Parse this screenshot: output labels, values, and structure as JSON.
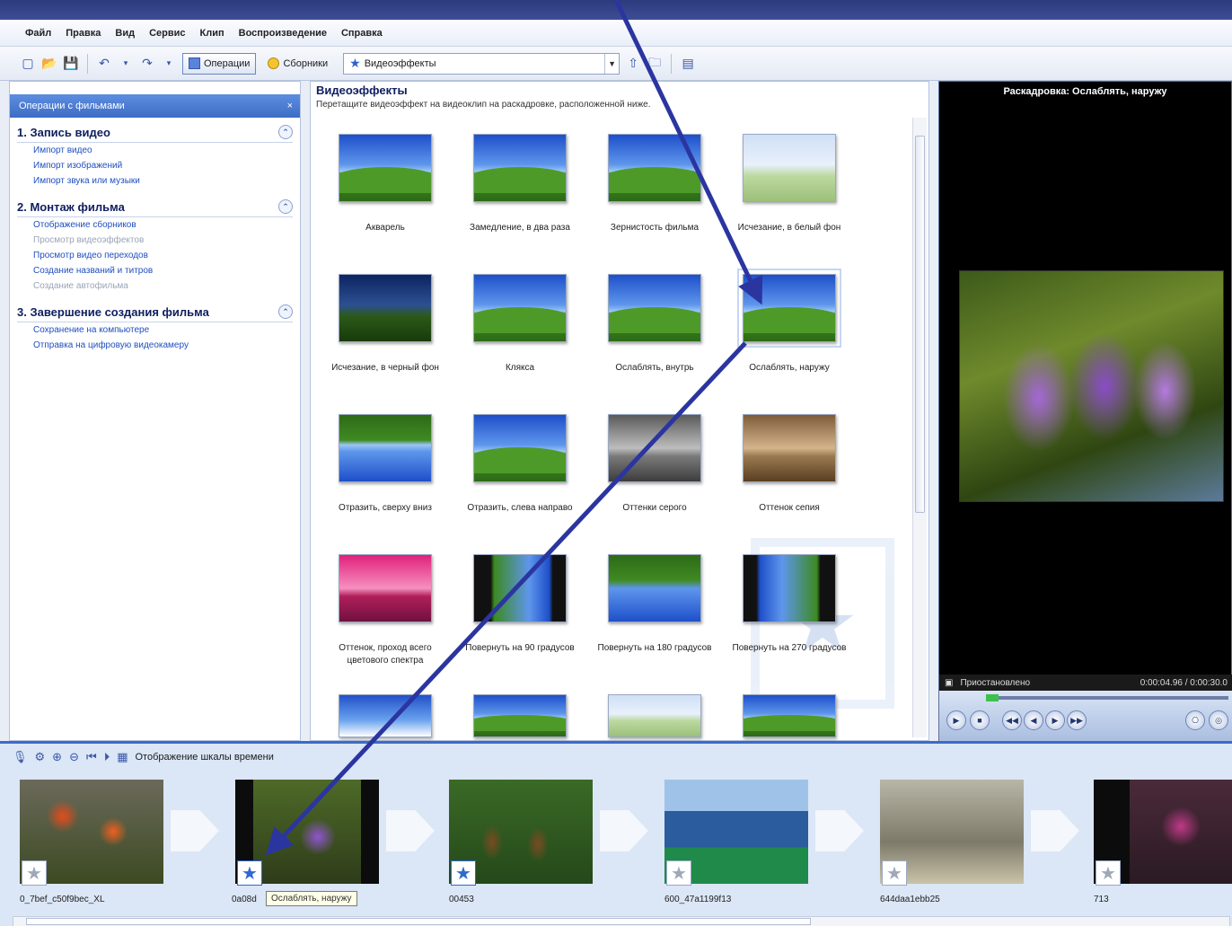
{
  "menu": [
    "Файл",
    "Правка",
    "Вид",
    "Сервис",
    "Клип",
    "Воспроизведение",
    "Справка"
  ],
  "toolbar": {
    "operations": "Операции",
    "collections": "Сборники",
    "combo_value": "Видеоэффекты"
  },
  "taskpane": {
    "header": "Операции с фильмами",
    "groups": [
      {
        "title": "1. Запись видео",
        "links": [
          "Импорт видео",
          "Импорт изображений",
          "Импорт звука или музыки"
        ]
      },
      {
        "title": "2. Монтаж фильма",
        "links": [
          "Отображение сборников",
          "Просмотр видеоэффектов",
          "Просмотр видео переходов",
          "Создание названий и титров",
          "Создание автофильма"
        ]
      },
      {
        "title": "3. Завершение создания фильма",
        "links": [
          "Сохранение на компьютере",
          "Отправка на цифровую видеокамеру"
        ]
      }
    ]
  },
  "center": {
    "title": "Видеоэффекты",
    "subtitle": "Перетащите видеоэффект на видеоклип на раскадровке, расположенной ниже.",
    "effects": [
      "Акварель",
      "Замедление, в два раза",
      "Зернистость фильма",
      "Исчезание, в белый фон",
      "Исчезание, в черный фон",
      "Клякса",
      "Ослаблять, внутрь",
      "Ослаблять, наружу",
      "Отразить, сверху вниз",
      "Отразить, слева направо",
      "Оттенки серого",
      "Оттенок сепия",
      "Оттенок, проход всего цветового спектра",
      "Повернуть на 90 градусов",
      "Повернуть на 180 градусов",
      "Повернуть на 270 градусов"
    ]
  },
  "preview": {
    "title": "Раскадровка: Ослаблять, наружу",
    "status": "Приостановлено",
    "time": "0:00:04.96 / 0:00:30.0"
  },
  "storyboard": {
    "toolbar_label": "Отображение шкалы времени",
    "tooltip": "Ослаблять, наружу",
    "clips": [
      "0_7bef_c50f9bec_XL",
      "0a08d",
      "00453",
      "600_47a1199f13",
      "644daa1ebb25",
      "713"
    ]
  },
  "colors": {
    "accent": "#3c6cc8",
    "arrow": "#2b35a0",
    "link": "#1f4fc0"
  }
}
